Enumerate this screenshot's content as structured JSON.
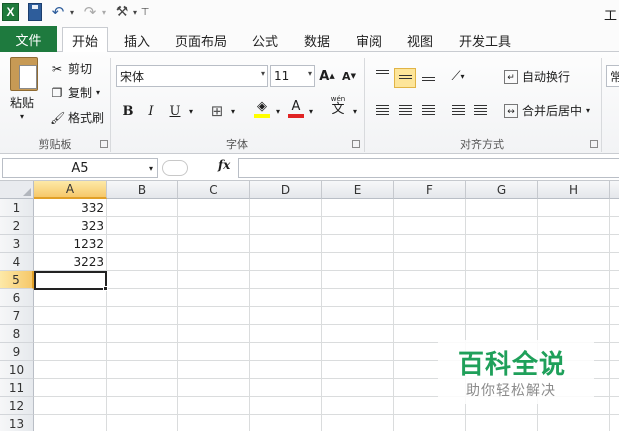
{
  "qat": {
    "app_icon_letter": "X",
    "right_partial_title": "工"
  },
  "tabs": [
    "文件",
    "开始",
    "插入",
    "页面布局",
    "公式",
    "数据",
    "审阅",
    "视图",
    "开发工具"
  ],
  "ribbon": {
    "clipboard": {
      "paste": "粘贴",
      "cut": "剪切",
      "copy": "复制",
      "format_painter": "格式刷",
      "label": "剪贴板"
    },
    "font": {
      "name": "宋体",
      "size": "11",
      "grow": "A",
      "shrink": "A",
      "bold": "B",
      "italic": "I",
      "underline": "U",
      "font_color_letter": "A",
      "phonetic_top": "wén",
      "phonetic_char": "文",
      "label": "字体",
      "font_color": "#e02424",
      "fill_color": "#ffff00"
    },
    "alignment": {
      "wrap_text": "自动换行",
      "merge_center": "合并后居中",
      "label": "对齐方式"
    },
    "number": {
      "partial": "常"
    }
  },
  "formula_bar": {
    "name_box": "A5",
    "fx": "fx",
    "formula": ""
  },
  "grid": {
    "columns": [
      "A",
      "B",
      "C",
      "D",
      "E",
      "F",
      "G",
      "H"
    ],
    "rows": [
      "1",
      "2",
      "3",
      "4",
      "5",
      "6",
      "7",
      "8",
      "9",
      "10",
      "11",
      "12",
      "13"
    ],
    "selected_column": "A",
    "selected_row": "5",
    "cells": {
      "A1": "332",
      "A2": "323",
      "A3": "1232",
      "A4": "3223"
    }
  },
  "watermark": {
    "title": "百科全说",
    "subtitle": "助你轻松解决"
  }
}
